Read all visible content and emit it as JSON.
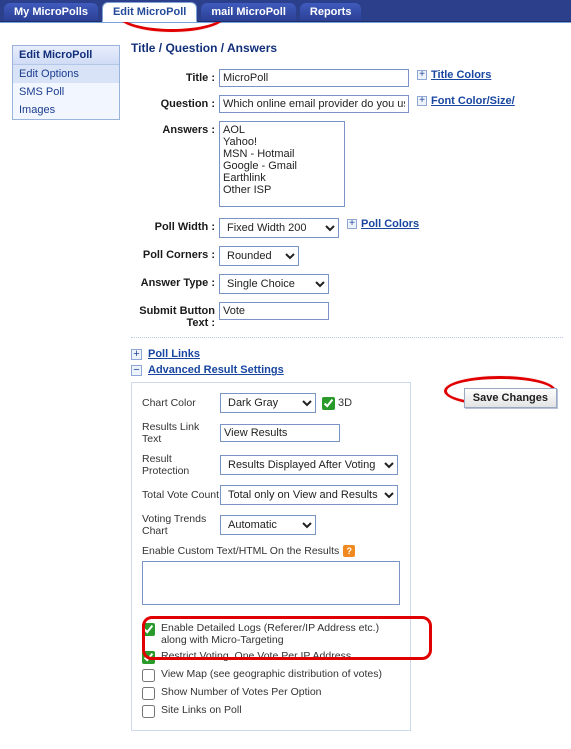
{
  "tabs": {
    "items": [
      {
        "label": "My MicroPolls"
      },
      {
        "label": "Edit MicroPoll"
      },
      {
        "label": "mail MicroPoll"
      },
      {
        "label": "Reports"
      }
    ]
  },
  "sidebar": {
    "title": "Edit MicroPoll",
    "items": [
      {
        "label": "Edit Options"
      },
      {
        "label": "SMS Poll"
      },
      {
        "label": "Images"
      }
    ]
  },
  "main": {
    "heading": "Title / Question / Answers",
    "fields": {
      "title_label": "Title :",
      "title_value": "MicroPoll",
      "title_colors_link": "Title Colors",
      "question_label": "Question :",
      "question_value": "Which online email provider do you use?",
      "font_link": "Font Color/Size/",
      "answers_label": "Answers :",
      "answers_value": "AOL\nYahoo!\nMSN - Hotmail\nGoogle - Gmail\nEarthlink\nOther ISP",
      "pollwidth_label": "Poll Width :",
      "pollwidth_value": "Fixed Width 200",
      "pollcolors_link": "Poll Colors",
      "corners_label": "Poll Corners :",
      "corners_value": "Rounded",
      "atype_label": "Answer Type :",
      "atype_value": "Single Choice",
      "submit_label": "Submit Button Text :",
      "submit_value": "Vote"
    },
    "sections": {
      "polllinks": "Poll Links",
      "advanced": "Advanced Result Settings"
    },
    "advanced": {
      "chart_color_label": "Chart Color",
      "chart_color_value": "Dark Gray",
      "threeD_label": "3D",
      "results_link_label": "Results Link Text",
      "results_link_value": "View Results",
      "result_protection_label": "Result Protection",
      "result_protection_value": "Results Displayed After Voting",
      "total_vote_label": "Total Vote Count",
      "total_vote_value": "Total only on View and Results",
      "voting_trends_label": "Voting Trends Chart",
      "voting_trends_value": "Automatic",
      "custom_text_label": "Enable Custom Text/HTML On the Results",
      "check_detailed": "Enable Detailed Logs (Referer/IP Address etc.) along with Micro-Targeting",
      "check_restrict": "Restrict Voting, One Vote Per IP Address",
      "check_viewmap": "View Map (see geographic distribution of votes)",
      "check_shownum": "Show Number of Votes Per Option",
      "check_sitelinks": "Site Links on Poll"
    },
    "save_label": "Save Changes"
  }
}
